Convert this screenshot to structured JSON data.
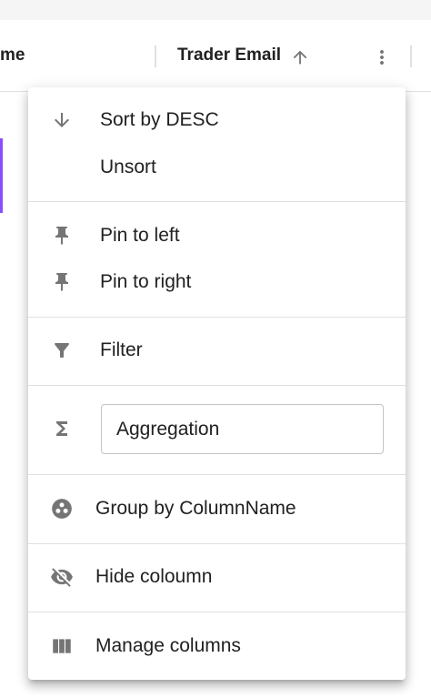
{
  "header": {
    "prev_column_fragment": "me",
    "column_title": "Trader Email"
  },
  "menu": {
    "sort_desc": "Sort by DESC",
    "unsort": "Unsort",
    "pin_left": "Pin to left",
    "pin_right": "Pin to right",
    "filter": "Filter",
    "aggregation": "Aggregation",
    "group_by": "Group by ColumnName",
    "hide_column": "Hide coloumn",
    "manage_columns": "Manage columns"
  },
  "icons": {
    "sort": "arrow-upward-icon",
    "column_menu": "more-vert-icon",
    "sort_desc": "arrow-downward-icon",
    "pin": "push-pin-icon",
    "filter": "filter-icon",
    "aggregation": "sigma-icon",
    "group_by": "workspaces-icon",
    "hide": "visibility-off-icon",
    "manage": "view-column-icon"
  },
  "colors": {
    "accent": "#8a4dff",
    "icon": "#757575",
    "text": "#212121",
    "divider": "#e0e0e0"
  }
}
